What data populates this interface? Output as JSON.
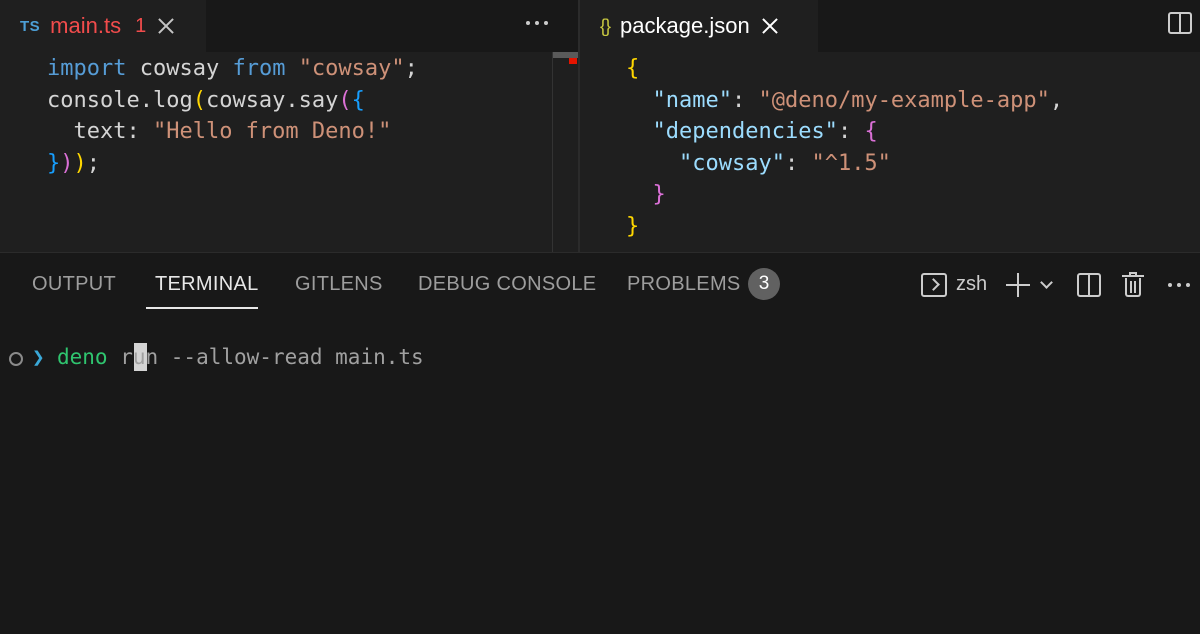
{
  "editor_left": {
    "tab": {
      "icon": "TS",
      "filename": "main.ts",
      "problem_count": "1"
    },
    "code": [
      [
        {
          "t": "import",
          "c": "kw"
        },
        {
          "t": " cowsay ",
          "c": "id"
        },
        {
          "t": "from",
          "c": "kw"
        },
        {
          "t": " ",
          "c": "id"
        },
        {
          "t": "\"cowsay\"",
          "c": "str"
        },
        {
          "t": ";",
          "c": "id"
        }
      ],
      [
        {
          "t": "console.log",
          "c": "id"
        },
        {
          "t": "(",
          "c": "b1"
        },
        {
          "t": "cowsay.say",
          "c": "id"
        },
        {
          "t": "(",
          "c": "b2"
        },
        {
          "t": "{",
          "c": "b3"
        }
      ],
      [
        {
          "t": "  text: ",
          "c": "id"
        },
        {
          "t": "\"Hello from Deno!\"",
          "c": "str"
        }
      ],
      [
        {
          "t": "}",
          "c": "b3"
        },
        {
          "t": ")",
          "c": "b2"
        },
        {
          "t": ")",
          "c": "b1"
        },
        {
          "t": ";",
          "c": "id"
        }
      ]
    ]
  },
  "editor_right": {
    "tab": {
      "icon": "{}",
      "filename": "package.json"
    },
    "code": [
      [
        {
          "t": "{",
          "c": "b1"
        }
      ],
      [
        {
          "t": "  ",
          "c": "id"
        },
        {
          "t": "\"name\"",
          "c": "prop"
        },
        {
          "t": ": ",
          "c": "id"
        },
        {
          "t": "\"@deno/my-example-app\"",
          "c": "str"
        },
        {
          "t": ",",
          "c": "id"
        }
      ],
      [
        {
          "t": "  ",
          "c": "id"
        },
        {
          "t": "\"dependencies\"",
          "c": "prop"
        },
        {
          "t": ": ",
          "c": "id"
        },
        {
          "t": "{",
          "c": "b2"
        }
      ],
      [
        {
          "t": "    ",
          "c": "id"
        },
        {
          "t": "\"cowsay\"",
          "c": "prop"
        },
        {
          "t": ": ",
          "c": "id"
        },
        {
          "t": "\"^1.5\"",
          "c": "str"
        }
      ],
      [
        {
          "t": "  ",
          "c": "id"
        },
        {
          "t": "}",
          "c": "b2"
        }
      ],
      [
        {
          "t": "}",
          "c": "b1"
        }
      ]
    ]
  },
  "panel": {
    "tabs": [
      {
        "label": "OUTPUT",
        "active": false
      },
      {
        "label": "TERMINAL",
        "active": true
      },
      {
        "label": "GITLENS",
        "active": false
      },
      {
        "label": "DEBUG CONSOLE",
        "active": false
      },
      {
        "label": "PROBLEMS",
        "active": false
      }
    ],
    "problems_badge": "3",
    "shell_name": "zsh"
  },
  "terminal": {
    "prompt": "❯",
    "command_name": "deno",
    "command_args": " run --allow-read main.ts"
  },
  "icons": {
    "more_actions": "ellipsis-icon",
    "split_editor": "split-editor-icon",
    "new_terminal": "plus-icon",
    "terminal_dropdown": "chevron-down-icon",
    "split_terminal": "split-terminal-icon",
    "kill_terminal": "trash-icon"
  }
}
